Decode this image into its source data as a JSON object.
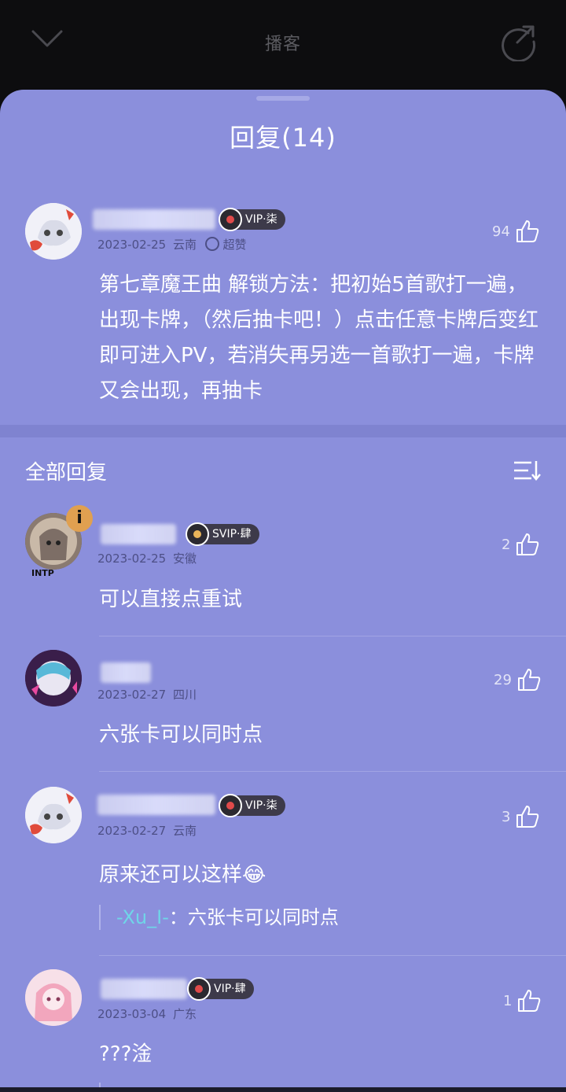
{
  "topbar": {
    "title": "播客"
  },
  "sheet": {
    "title": "回复(14)"
  },
  "main_comment": {
    "badge": "VIP·柒",
    "date": "2023-02-25",
    "location": "云南",
    "tag": "超赞",
    "likes": "94",
    "text": "第七章魔王曲 解锁方法：把初始5首歌打一遍，出现卡牌，（然后抽卡吧！）点击任意卡牌后变红即可进入PV，若消失再另选一首歌打一遍，卡牌又会出现，再抽卡"
  },
  "section": {
    "title": "全部回复"
  },
  "replies": [
    {
      "badge": "SVIP·肆",
      "date": "2023-02-25",
      "location": "安徽",
      "likes": "2",
      "text": "可以直接点重试",
      "avatar_label": "INTP"
    },
    {
      "badge": "",
      "date": "2023-02-27",
      "location": "四川",
      "likes": "29",
      "text": "六张卡可以同时点"
    },
    {
      "badge": "VIP·柒",
      "date": "2023-02-27",
      "location": "云南",
      "likes": "3",
      "text": "原来还可以这样😂",
      "quote_name": "-Xu_I-",
      "quote_text": "：六张卡可以同时点"
    },
    {
      "badge": "VIP·肆",
      "date": "2023-03-04",
      "location": "广东",
      "likes": "1",
      "text": "???淦"
    }
  ],
  "colors": {
    "sheet_bg": "#8b8fdc",
    "text": "#ffffff",
    "meta": "#4d4f86",
    "quote_name": "#6fd6e8"
  }
}
